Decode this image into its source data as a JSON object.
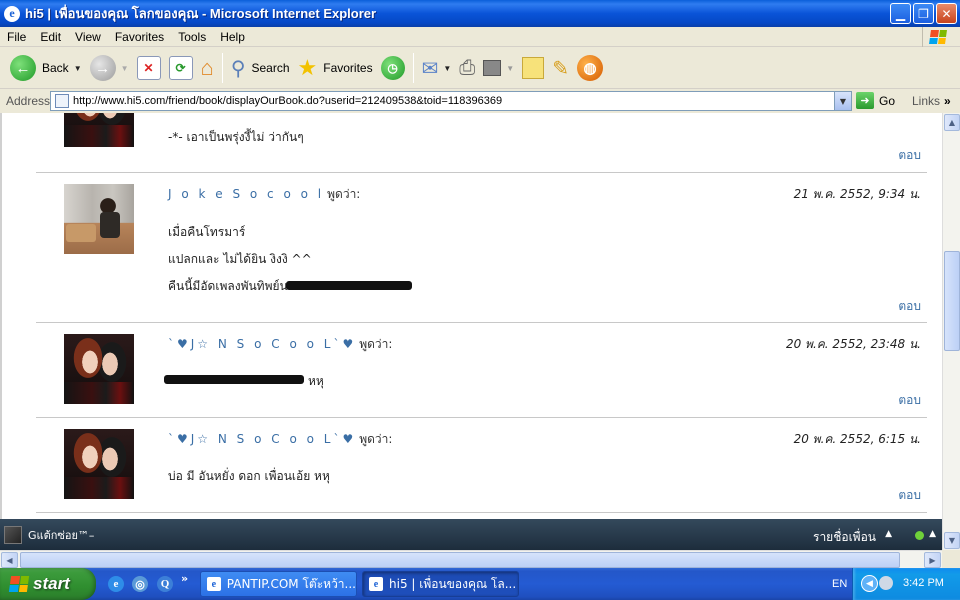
{
  "window": {
    "title": "hi5 | เพื่อนของคุณ โลกของคุณ - Microsoft Internet Explorer",
    "icon": "ie-icon",
    "buttons": [
      "minimize",
      "maximize",
      "close"
    ]
  },
  "menu": [
    "File",
    "Edit",
    "View",
    "Favorites",
    "Tools",
    "Help"
  ],
  "toolbar": {
    "back": "Back",
    "search": "Search",
    "favorites": "Favorites"
  },
  "address": {
    "label": "Address",
    "url": "http://www.hi5.com/friend/book/displayOurBook.do?userid=212409538&toid=118396369",
    "go": "Go",
    "links": "Links"
  },
  "entries": [
    {
      "name": "",
      "said": "",
      "date": "",
      "lines": [
        "-*- เอาเป็นพรุ่งงี้ไม่ ว่ากันๆ"
      ],
      "reply": "ตอบ",
      "avatar": "couple-photo"
    },
    {
      "name": "J o k e S o c o o l",
      "said": "พูดว่า:",
      "date": "21 พ.ค. 2552, 9:34 น.",
      "lines": [
        "เมื่อคืนโทรมาร์",
        "แปลกและ ไม่ได้ยิน งิงงิ ^^",
        "คืนนี้มีอัดเพลงพันทิพย์นะ"
      ],
      "reply": "ตอบ",
      "avatar": "outdoor-photo"
    },
    {
      "name": "`♥J☆ N S o C o o L`♥",
      "said": "พูดว่า:",
      "date": "20 พ.ค. 2552, 23:48 น.",
      "lines": [
        "หหุ"
      ],
      "reply": "ตอบ",
      "avatar": "couple-photo"
    },
    {
      "name": "`♥J☆ N S o C o o L`♥",
      "said": "พูดว่า:",
      "date": "20 พ.ค. 2552, 6:15 น.",
      "lines": [
        "บ่อ มี อันหยั่ง ดอก เพื่อนเอ้ย หหุ"
      ],
      "reply": "ตอบ",
      "avatar": "couple-photo"
    }
  ],
  "friendbar": {
    "name": "Gแต้กซ่อย™–",
    "friend_list": "รายชื่อเพื่อน",
    "status_color": "#6fd13a"
  },
  "taskbar": {
    "start": "start",
    "tasks": [
      "PANTIP.COM โต๊ะหว้า...",
      "hi5 | เพื่อนของคุณ โล..."
    ],
    "language": "EN",
    "clock": "3:42 PM"
  },
  "colors": {
    "titlebar": "#0a54d8",
    "link": "#3a6ea5",
    "taskbar": "#245bd3",
    "start": "#2f8e2f"
  }
}
